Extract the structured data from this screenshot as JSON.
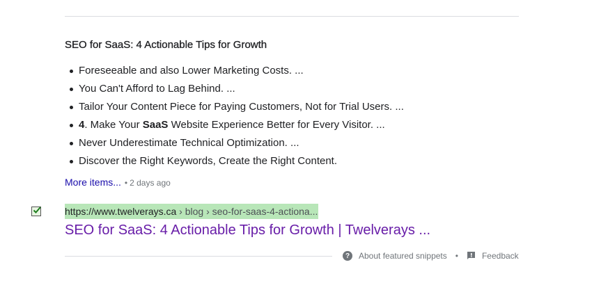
{
  "snippet": {
    "title": "SEO for SaaS: 4 Actionable Tips for Growth",
    "items": [
      {
        "prefix": "",
        "middle_bold": "",
        "text": "Foreseeable and also Lower Marketing Costs. ..."
      },
      {
        "prefix": "",
        "middle_bold": "",
        "text": "You Can't Afford to Lag Behind. ..."
      },
      {
        "prefix": "",
        "middle_bold": "",
        "text": "Tailor Your Content Piece for Paying Customers, Not for Trial Users. ..."
      },
      {
        "prefix": "4",
        "before_bold": ". Make Your ",
        "middle_bold": "SaaS",
        "text": " Website Experience Better for Every Visitor. ..."
      },
      {
        "prefix": "",
        "middle_bold": "",
        "text": "Never Underestimate Technical Optimization. ..."
      },
      {
        "prefix": "",
        "middle_bold": "",
        "text": "Discover the Right Keywords, Create the Right Content."
      }
    ],
    "more_items_label": "More items...",
    "separator": "•",
    "date": "2 days ago"
  },
  "result": {
    "url_domain": "https://www.twelverays.ca",
    "url_path": " › blog › seo-for-saas-4-actiona...",
    "title": "SEO for SaaS: 4 Actionable Tips for Growth | Twelverays ...",
    "checkbox_checked": true
  },
  "footer": {
    "about_label": "About featured snippets",
    "separator": "•",
    "feedback_label": "Feedback"
  },
  "colors": {
    "link": "#1a0dab",
    "visited_link": "#681da8",
    "url_highlight": "#b8e6b8",
    "text": "#202124",
    "muted": "#70757a"
  },
  "icons": {
    "checkbox": "checkbox-checked-icon",
    "help": "help-circle-icon",
    "feedback": "feedback-icon"
  }
}
